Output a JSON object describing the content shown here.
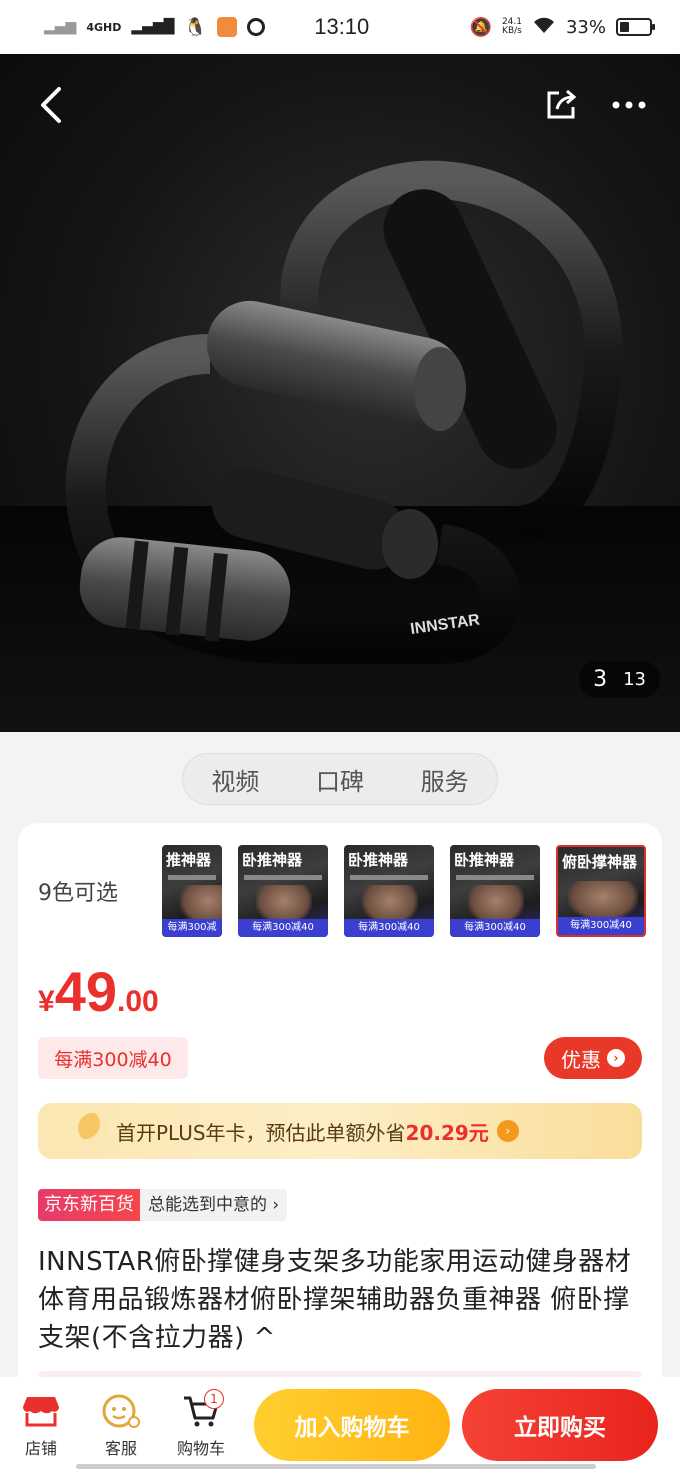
{
  "status_bar": {
    "network": "4GHD",
    "time": "13:10",
    "net_speed_value": "24.1",
    "net_speed_unit": "KB/s",
    "battery": "33%",
    "battery_level": 0.33
  },
  "hero": {
    "image_index": "3",
    "image_total": "13",
    "brand_mark": "INNSTAR"
  },
  "tabs": [
    "视频",
    "口碑",
    "服务"
  ],
  "colors": {
    "label": "9色可选",
    "thumbnails": [
      {
        "title": "推神器"
      },
      {
        "title": "卧推神器"
      },
      {
        "title": "卧推神器"
      },
      {
        "title": "卧推神器"
      },
      {
        "title": "俯卧撑神器",
        "selected": true
      }
    ],
    "thumb_promo": "每满300减40"
  },
  "price": {
    "currency": "¥",
    "integer": "49",
    "decimal": ".00"
  },
  "promo_tag": "每满300减40",
  "discount_button": "优惠",
  "plus_banner": {
    "text": "首开PLUS年卡，预估此单额外省",
    "amount": "20.29元"
  },
  "store": {
    "badge": "京东新百货",
    "slogan": "总能选到中意的 ›"
  },
  "product_title": "INNSTAR俯卧撑健身支架多功能家用运动健身器材体育用品锻炼器材俯卧撑架辅助器负重神器 俯卧撑支架(不含拉力器) ^",
  "bottom_bar": {
    "store_label": "店铺",
    "service_label": "客服",
    "cart_label": "购物车",
    "cart_count": "1",
    "add_to_cart": "加入购物车",
    "buy_now": "立即购买"
  },
  "theme": {
    "accent_red": "#e9302c",
    "cart_yellow": "#ffc21f"
  }
}
